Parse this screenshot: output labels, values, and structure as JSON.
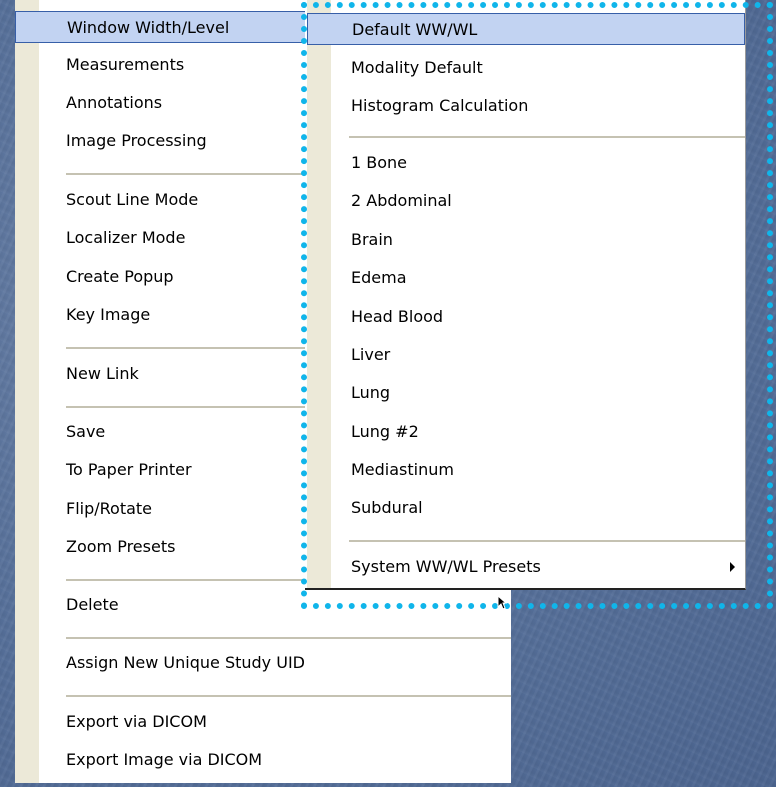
{
  "context_menu": {
    "items": [
      "Window Width/Level",
      "Measurements",
      "Annotations",
      "Image Processing",
      "Scout Line Mode",
      "Localizer Mode",
      "Create Popup",
      "Key Image",
      "New Link",
      "Save",
      "To Paper Printer",
      "Flip/Rotate",
      "Zoom Presets",
      "Delete",
      "Assign New Unique Study UID",
      "Export via DICOM",
      "Export Image via DICOM"
    ]
  },
  "submenu": {
    "items": [
      "Default WW/WL",
      "Modality Default",
      "Histogram Calculation",
      "1 Bone",
      "2 Abdominal",
      "Brain",
      "Edema",
      "Head Blood",
      "Liver",
      "Lung",
      "Lung #2",
      "Mediastinum",
      "Subdural",
      "System WW/WL Presets"
    ]
  },
  "colors": {
    "selection_fill": "#c2d3f2",
    "highlight_border": "#10b5ea",
    "gutter": "#ece9d8"
  },
  "icons": {
    "submenu_arrow": "submenu-arrow-icon",
    "cursor": "mouse-cursor-icon"
  }
}
